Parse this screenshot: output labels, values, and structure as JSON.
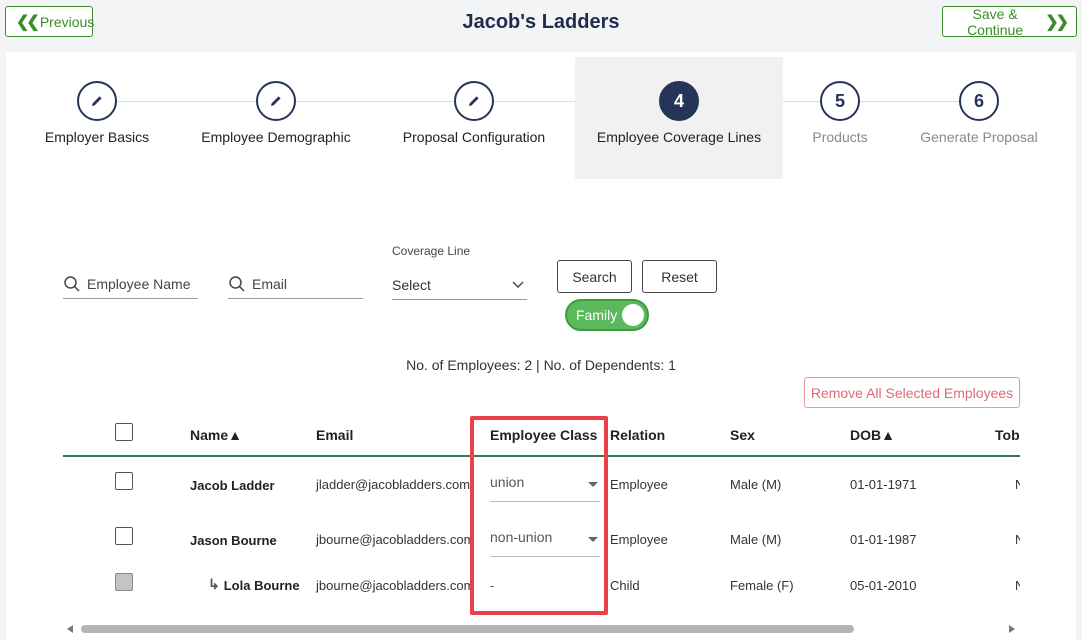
{
  "header": {
    "previous_label": "Previous",
    "title": "Jacob's Ladders",
    "continue_label": "Save & Continue"
  },
  "steps": [
    {
      "label": "Employer Basics",
      "state": "done",
      "icon": "pencil-icon"
    },
    {
      "label": "Employee Demographic",
      "state": "done",
      "icon": "pencil-icon"
    },
    {
      "label": "Proposal Configuration",
      "state": "done",
      "icon": "pencil-icon"
    },
    {
      "number": "4",
      "label": "Employee Coverage Lines",
      "state": "active"
    },
    {
      "number": "5",
      "label": "Products",
      "state": "pending"
    },
    {
      "number": "6",
      "label": "Generate Proposal",
      "state": "pending"
    }
  ],
  "filters": {
    "employee_name_placeholder": "Employee Name",
    "email_placeholder": "Email",
    "coverage_line_label": "Coverage Line",
    "coverage_line_value": "Select",
    "search_label": "Search",
    "reset_label": "Reset",
    "family_toggle_label": "Family",
    "family_toggle_on": true
  },
  "summary": {
    "counts_text": "No. of Employees: 2 | No. of Dependents: 1",
    "remove_all_label": "Remove All Selected Employees"
  },
  "table": {
    "columns": [
      "Name▲",
      "Email",
      "Employee Class",
      "Relation",
      "Sex",
      "DOB▲",
      "Tob"
    ],
    "rows": [
      {
        "name": "Jacob Ladder",
        "email": "jladder@jacobladders.com",
        "employee_class": "union",
        "relation": "Employee",
        "sex": "Male (M)",
        "dob": "01-01-1971",
        "tob": "N"
      },
      {
        "name": "Jason Bourne",
        "email": "jbourne@jacobladders.com",
        "employee_class": "non-union",
        "relation": "Employee",
        "sex": "Male (M)",
        "dob": "01-01-1987",
        "tob": "N"
      },
      {
        "name": "Lola Bourne",
        "email": "jbourne@jacobladders.com",
        "employee_class": "-",
        "relation": "Child",
        "sex": "Female (F)",
        "dob": "05-01-2010",
        "tob": "N",
        "dependent": true
      }
    ]
  },
  "colors": {
    "accent_green": "#3a8d2a",
    "navy": "#26345a",
    "highlight_red": "#e8414a",
    "remove_red": "#e16a76"
  }
}
